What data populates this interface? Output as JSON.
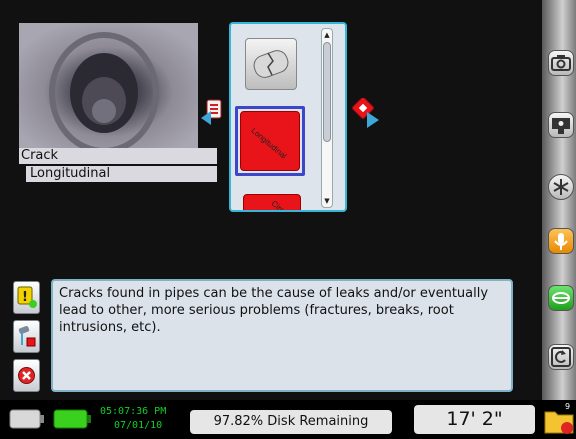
{
  "observation": {
    "category": "Crack",
    "subcategory": "Longitudinal",
    "tile_label": "Longitudinal",
    "next_tile_label": "Circu",
    "description": "Cracks found in pipes can be the cause of leaks and/or eventually lead to other, more serious problems (fractures, breaks, root intrusions, etc)."
  },
  "status": {
    "time": "05:07:36 PM",
    "date": "07/01/10",
    "disk": "97.82% Disk Remaining",
    "distance": "17' 2\"",
    "folder_count": "9"
  },
  "icons": {
    "left_side": [
      "hint-icon",
      "pipe-flag-icon",
      "cancel-icon"
    ],
    "right_side": [
      "camera-icon",
      "video-icon",
      "asterisk-icon",
      "mic-icon",
      "tape-icon",
      "rewind-icon"
    ]
  },
  "colors": {
    "accent": "#35b6d6",
    "tile_red": "#e8141a",
    "selection": "#3b46c8",
    "status_green": "#0fd126",
    "battery_green": "#39d11e"
  }
}
